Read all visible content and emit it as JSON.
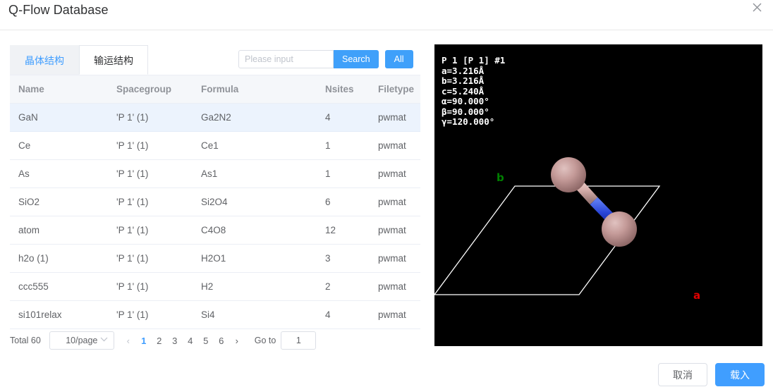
{
  "header": {
    "title": "Q-Flow Database",
    "close_icon": "close-icon"
  },
  "tabs": [
    {
      "label": "晶体结构",
      "active": true
    },
    {
      "label": "输运结构",
      "active": false
    }
  ],
  "search": {
    "placeholder": "Please input",
    "value": "",
    "search_label": "Search",
    "all_label": "All"
  },
  "table": {
    "columns": [
      "Name",
      "Spacegroup",
      "Formula",
      "Nsites",
      "Filetype"
    ],
    "rows": [
      {
        "name": "GaN",
        "spacegroup": "'P 1' (1)",
        "formula": "Ga2N2",
        "nsites": "4",
        "filetype": "pwmat",
        "selected": true
      },
      {
        "name": "Ce",
        "spacegroup": "'P 1' (1)",
        "formula": "Ce1",
        "nsites": "1",
        "filetype": "pwmat",
        "selected": false
      },
      {
        "name": "As",
        "spacegroup": "'P 1' (1)",
        "formula": "As1",
        "nsites": "1",
        "filetype": "pwmat",
        "selected": false
      },
      {
        "name": "SiO2",
        "spacegroup": "'P 1' (1)",
        "formula": "Si2O4",
        "nsites": "6",
        "filetype": "pwmat",
        "selected": false
      },
      {
        "name": "atom",
        "spacegroup": "'P 1' (1)",
        "formula": "C4O8",
        "nsites": "12",
        "filetype": "pwmat",
        "selected": false
      },
      {
        "name": "h2o (1)",
        "spacegroup": "'P 1' (1)",
        "formula": "H2O1",
        "nsites": "3",
        "filetype": "pwmat",
        "selected": false
      },
      {
        "name": "ccc555",
        "spacegroup": "'P 1' (1)",
        "formula": "H2",
        "nsites": "2",
        "filetype": "pwmat",
        "selected": false
      },
      {
        "name": "si101relax",
        "spacegroup": "'P 1' (1)",
        "formula": "Si4",
        "nsites": "4",
        "filetype": "pwmat",
        "selected": false
      }
    ]
  },
  "pagination": {
    "total_label": "Total 60",
    "page_size_label": "10/page",
    "prev_symbol": "‹",
    "next_symbol": "›",
    "pages": [
      "1",
      "2",
      "3",
      "4",
      "5",
      "6"
    ],
    "current_page": "1",
    "goto_label": "Go to",
    "goto_value": "1"
  },
  "viewer": {
    "spacegroup_line": "P 1 [P 1] #1",
    "a": "a=3.216Å",
    "b": "b=3.216Å",
    "c": "c=5.240Å",
    "alpha": "α=90.000°",
    "beta": "β=90.000°",
    "gamma": "γ=120.000°",
    "axis_a_label": "a",
    "axis_b_label": "b",
    "colors": {
      "background": "#000000",
      "cell_edge": "#ffffff",
      "atom": "#c3999a",
      "bond_blue": "#2a46d8",
      "axis_a": "#e00000",
      "axis_b": "#008000"
    }
  },
  "footer": {
    "cancel_label": "取消",
    "load_label": "载入"
  }
}
